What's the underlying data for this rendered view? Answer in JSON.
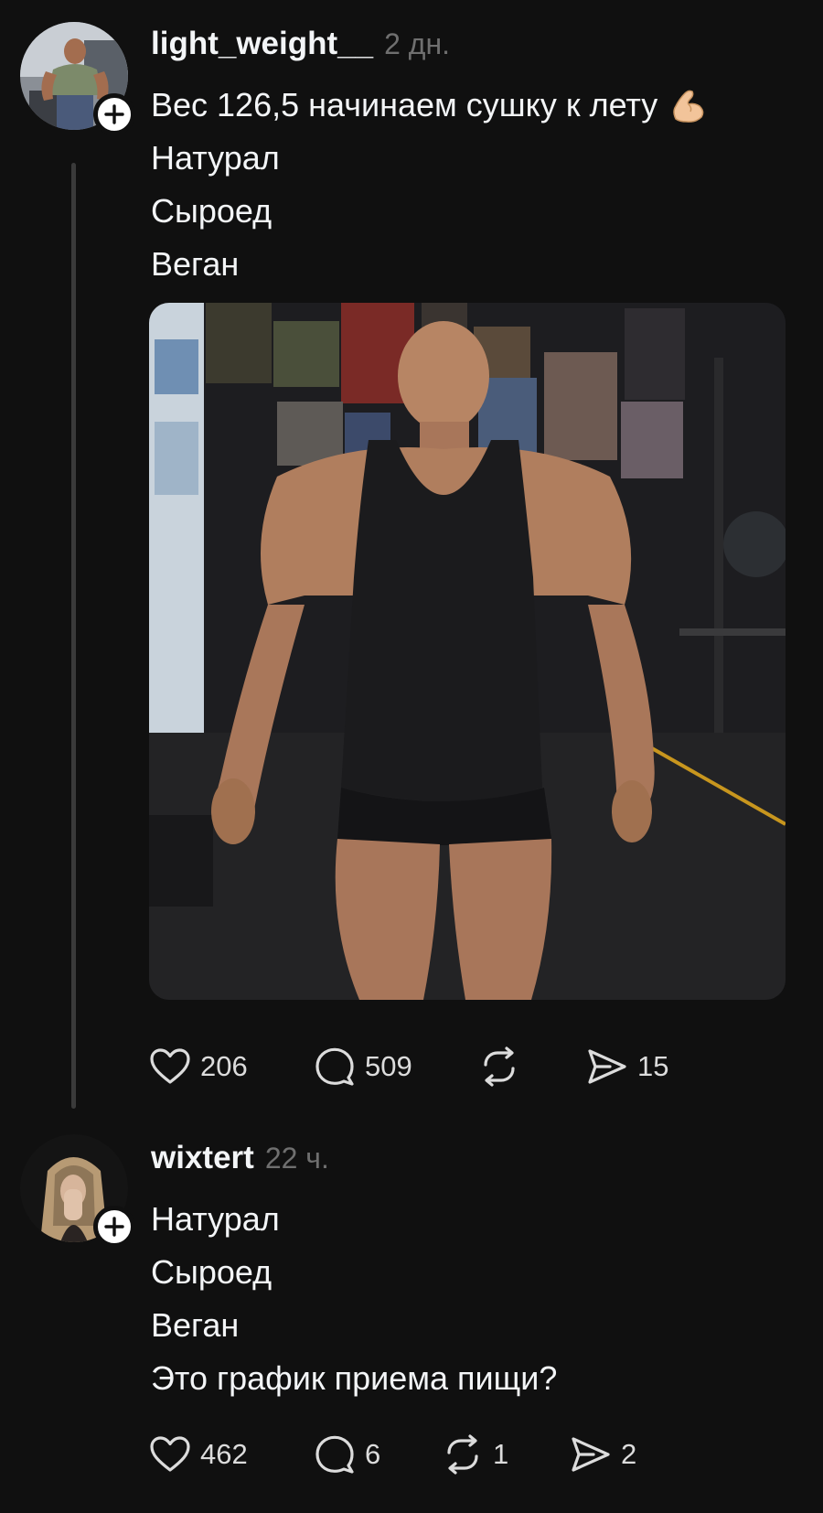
{
  "posts": [
    {
      "username": "light_weight__",
      "time": "2 дн.",
      "lines": [
        "Вес 126,5 начинаем сушку к лету",
        "Натурал",
        "Сыроед",
        "Веган"
      ],
      "emoji": "flexed-biceps",
      "image": "bodybuilder-gym-photo",
      "likes": "206",
      "comments": "509",
      "reposts": "",
      "shares": "15"
    },
    {
      "username": "wixtert",
      "time": "22 ч.",
      "lines": [
        "Натурал",
        "Сыроед",
        "Веган",
        "Это график приема пищи?"
      ],
      "likes": "462",
      "comments": "6",
      "reposts": "1",
      "shares": "2"
    }
  ],
  "colors": {
    "background": "#101010",
    "text": "#f3f5f7",
    "muted": "#6f6f6f",
    "thread_line": "#3a3a3a"
  }
}
